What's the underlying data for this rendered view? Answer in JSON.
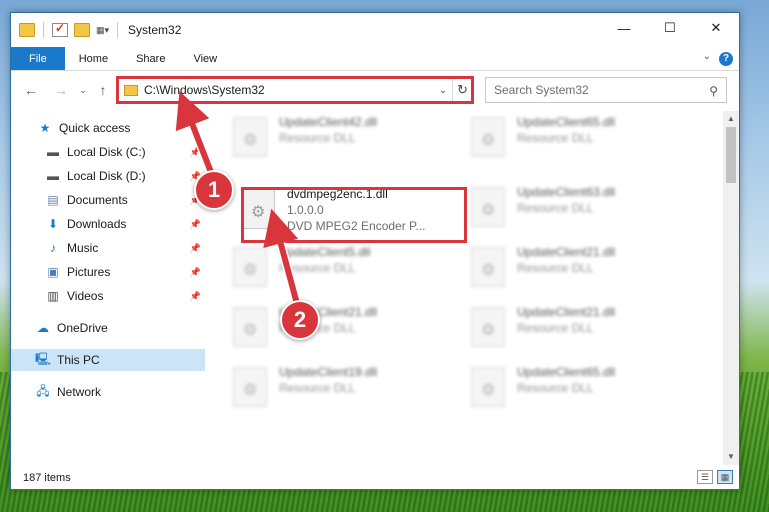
{
  "window": {
    "title": "System32",
    "controls": {
      "minimize": "—",
      "maximize": "☐",
      "close": "✕"
    }
  },
  "ribbon": {
    "tabs": [
      "File",
      "Home",
      "Share",
      "View"
    ],
    "help": "?"
  },
  "address_bar": {
    "path": "C:\\Windows\\System32",
    "refresh_icon": "↻"
  },
  "search": {
    "placeholder": "Search System32"
  },
  "sidebar": {
    "items": [
      {
        "label": "Quick access",
        "icon": "star-icon",
        "pinned": false
      },
      {
        "label": "Local Disk (C:)",
        "icon": "drive-icon",
        "pinned": true
      },
      {
        "label": "Local Disk (D:)",
        "icon": "drive-icon",
        "pinned": true
      },
      {
        "label": "Documents",
        "icon": "documents-icon",
        "pinned": true
      },
      {
        "label": "Downloads",
        "icon": "download-icon",
        "pinned": true
      },
      {
        "label": "Music",
        "icon": "music-icon",
        "pinned": true
      },
      {
        "label": "Pictures",
        "icon": "pictures-icon",
        "pinned": true
      },
      {
        "label": "Videos",
        "icon": "videos-icon",
        "pinned": true
      },
      {
        "label": "OneDrive",
        "icon": "cloud-icon",
        "pinned": false
      },
      {
        "label": "This PC",
        "icon": "computer-icon",
        "pinned": false,
        "selected": true
      },
      {
        "label": "Network",
        "icon": "network-icon",
        "pinned": false
      }
    ]
  },
  "files": {
    "focused": {
      "name": "dvdmpeg2enc.1.dll",
      "version": "1.0.0.0",
      "description": "DVD MPEG2 Encoder P..."
    },
    "left_column": [
      {
        "name": "UpdateClient42.dll",
        "type": "Resource DLL"
      },
      {
        "name": "UpdateClient5.dll",
        "type": "Resource DLL"
      },
      {
        "name": "UpdateClient21.dll",
        "type": "Resource DLL"
      },
      {
        "name": "UpdateClient19.dll",
        "type": "Resource DLL"
      }
    ],
    "right_column": [
      {
        "name": "UpdateClient65.dll",
        "type": "Resource DLL"
      },
      {
        "name": "UpdateClient63.dll",
        "type": "Resource DLL"
      },
      {
        "name": "UpdateClient21.dll",
        "type": "Resource DLL"
      },
      {
        "name": "UpdateClient21.dll",
        "type": "Resource DLL"
      },
      {
        "name": "UpdateClient65.dll",
        "type": "Resource DLL"
      }
    ]
  },
  "status": {
    "item_count": "187 items"
  },
  "annotations": {
    "step1": "1",
    "step2": "2"
  },
  "colors": {
    "accent": "#1979ca",
    "highlight": "#d9353d",
    "selection": "#cce4f7"
  }
}
